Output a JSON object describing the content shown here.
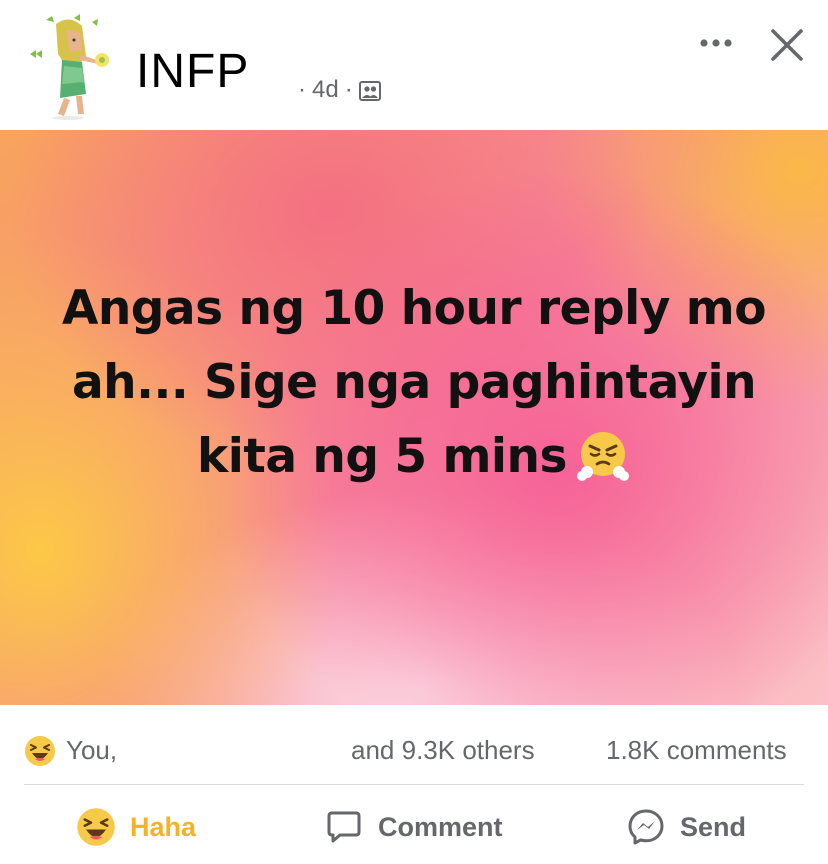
{
  "header": {
    "page_name": "INFP",
    "time": "4d",
    "separator": "·",
    "audience_icon": "group-audience-icon",
    "more_icon": "more-dots-icon",
    "close_icon": "close-icon"
  },
  "post": {
    "text": "Angas ng 10 hour reply mo ah... Sige nga paghintayin kita ng 5 mins",
    "emoji": "face-with-steam-from-nose"
  },
  "summary": {
    "reaction_icon": "haha-reaction-icon",
    "you": "You,",
    "others": "and 9.3K others",
    "comments": "1.8K comments"
  },
  "actions": {
    "haha_label": "Haha",
    "comment_label": "Comment",
    "send_label": "Send"
  },
  "colors": {
    "haha_accent": "#f7b125",
    "secondary_text": "#65676b",
    "post_text": "#111111"
  }
}
